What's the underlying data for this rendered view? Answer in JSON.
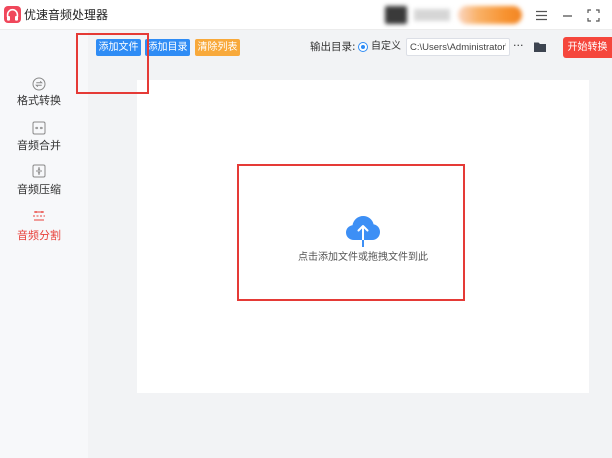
{
  "app": {
    "title": "优速音频处理器",
    "logo_icon": "headphones-icon"
  },
  "titlebar": {
    "menu_icon": "menu-icon",
    "minimize_icon": "minimize-icon",
    "fullscreen_icon": "fullscreen-icon"
  },
  "sidebar": {
    "items": [
      {
        "label": "格式转换",
        "icon": "format-convert-icon",
        "active": false
      },
      {
        "label": "音频合并",
        "icon": "audio-merge-icon",
        "active": false
      },
      {
        "label": "音频压缩",
        "icon": "audio-compress-icon",
        "active": false
      },
      {
        "label": "音频分割",
        "icon": "audio-split-icon",
        "active": true
      }
    ]
  },
  "toolbar": {
    "add_file_label": "添加文件",
    "add_folder_label": "添加目录",
    "clear_list_label": "清除列表",
    "output_dir_label": "输出目录:",
    "output_mode_option": "自定义",
    "output_mode_selected": true,
    "output_path": "C:\\Users\\Administrator\\",
    "more_label": "···",
    "folder_icon": "folder-icon",
    "start_label": "开始转换"
  },
  "dropzone": {
    "icon": "cloud-upload-icon",
    "hint": "点击添加文件或拖拽文件到此"
  },
  "colors": {
    "primary_blue": "#2f8cf5",
    "orange": "#f8a93b",
    "start_red": "#f5463c",
    "active_red": "#e8403a",
    "highlight_red": "#e53a36",
    "logo_pink": "#f0475b"
  }
}
